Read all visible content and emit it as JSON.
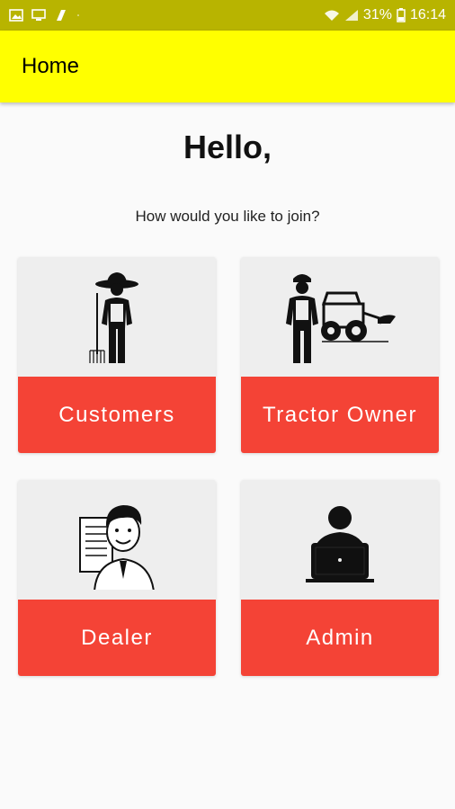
{
  "status_bar": {
    "battery": "31%",
    "time": "16:14",
    "icons": [
      "image-icon",
      "monitor-icon",
      "app-icon",
      "dot-icon",
      "wifi-icon",
      "signal-icon",
      "battery-icon"
    ]
  },
  "app_bar": {
    "title": "Home"
  },
  "main": {
    "greeting": "Hello,",
    "subtitle": "How would you like to join?"
  },
  "roles": [
    {
      "label": "Customers",
      "icon": "farmer-icon"
    },
    {
      "label": "Tractor Owner",
      "icon": "tractor-owner-icon"
    },
    {
      "label": "Dealer",
      "icon": "dealer-icon"
    },
    {
      "label": "Admin",
      "icon": "admin-laptop-icon"
    }
  ],
  "colors": {
    "status_bar": "#b8b400",
    "app_bar": "#ffff00",
    "card_label_bg": "#f44336",
    "card_bg": "#eeeeee"
  }
}
